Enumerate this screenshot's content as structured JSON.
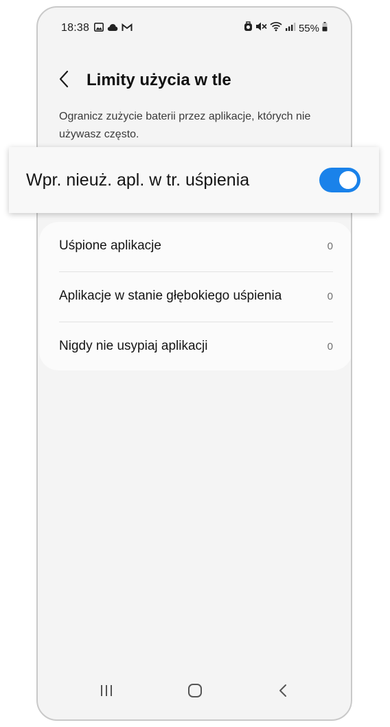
{
  "status_bar": {
    "time": "18:38",
    "battery_percent": "55%",
    "left_icons": [
      "image-icon",
      "cloud-icon",
      "gmail-icon"
    ],
    "right_icons": [
      "alarm-icon",
      "mute-icon",
      "wifi-icon",
      "signal-icon",
      "battery-icon"
    ]
  },
  "header": {
    "title": "Limity użycia w tle"
  },
  "description": "Ogranicz zużycie baterii przez aplikacje, których nie używasz często.",
  "toggle": {
    "label": "Wpr. nieuż. apl. w tr. uśpienia",
    "state": "on",
    "color": "#1a82ea"
  },
  "list": {
    "items": [
      {
        "label": "Uśpione aplikacje",
        "count": "0"
      },
      {
        "label": "Aplikacje w stanie głębokiego uśpienia",
        "count": "0"
      },
      {
        "label": "Nigdy nie usypiaj aplikacji",
        "count": "0"
      }
    ]
  },
  "nav_bar": {
    "buttons": [
      "recents-icon",
      "home-icon",
      "back-icon"
    ]
  }
}
